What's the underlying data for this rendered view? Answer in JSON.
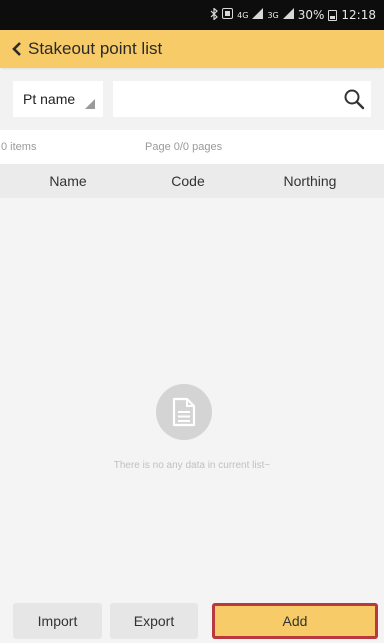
{
  "status_bar": {
    "signal_4g": "4G",
    "signal_3g": "3G",
    "battery": "30%",
    "time": "12:18"
  },
  "header": {
    "title": "Stakeout point list"
  },
  "search": {
    "filter_label": "Pt name",
    "placeholder": ""
  },
  "info": {
    "item_count": "0 items",
    "page": "Page 0/0 pages"
  },
  "table": {
    "columns": [
      "Name",
      "Code",
      "Northing"
    ]
  },
  "empty_state": {
    "message": "There is no any data in current list~"
  },
  "actions": {
    "import_label": "Import",
    "export_label": "Export",
    "add_label": "Add"
  },
  "colors": {
    "accent": "#f7cb68",
    "highlight": "#b9393e"
  }
}
